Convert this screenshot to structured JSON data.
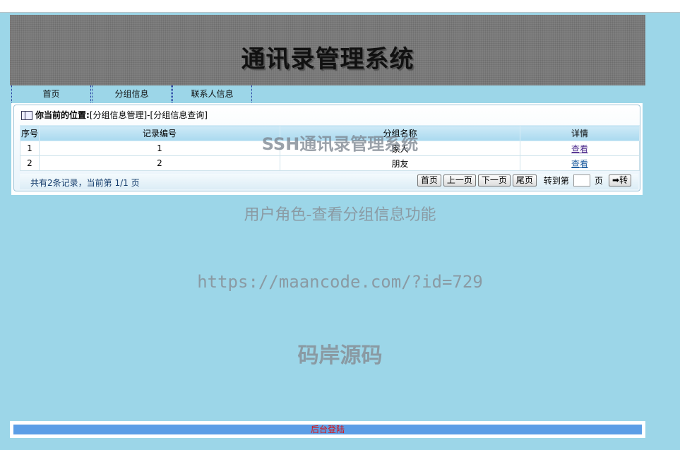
{
  "banner": {
    "title": "通讯录管理系统"
  },
  "nav": {
    "items": [
      {
        "label": "首页"
      },
      {
        "label": "分组信息"
      },
      {
        "label": "联系人信息"
      }
    ]
  },
  "breadcrumb": {
    "label": "你当前的位置:",
    "path": "[分组信息管理]-[分组信息查询]"
  },
  "table": {
    "headers": [
      "序号",
      "记录编号",
      "分组名称",
      "详情"
    ],
    "rows": [
      {
        "index": "1",
        "record_no": "1",
        "group_name": "家人",
        "action": "查看"
      },
      {
        "index": "2",
        "record_no": "2",
        "group_name": "朋友",
        "action": "查看"
      }
    ]
  },
  "pager": {
    "summary": "共有2条记录，当前第 1/1 页",
    "first": "首页",
    "prev": "上一页",
    "next": "下一页",
    "last": "尾页",
    "goto_label": "转到第",
    "page_unit": "页",
    "go_label": "➡转"
  },
  "watermarks": {
    "line1": "SSH通讯录管理系统",
    "line2": "用户角色-查看分组信息功能",
    "line3": "https://maancode.com/?id=729",
    "line4": "码岸源码"
  },
  "footer": {
    "login_link": "后台登陆"
  }
}
